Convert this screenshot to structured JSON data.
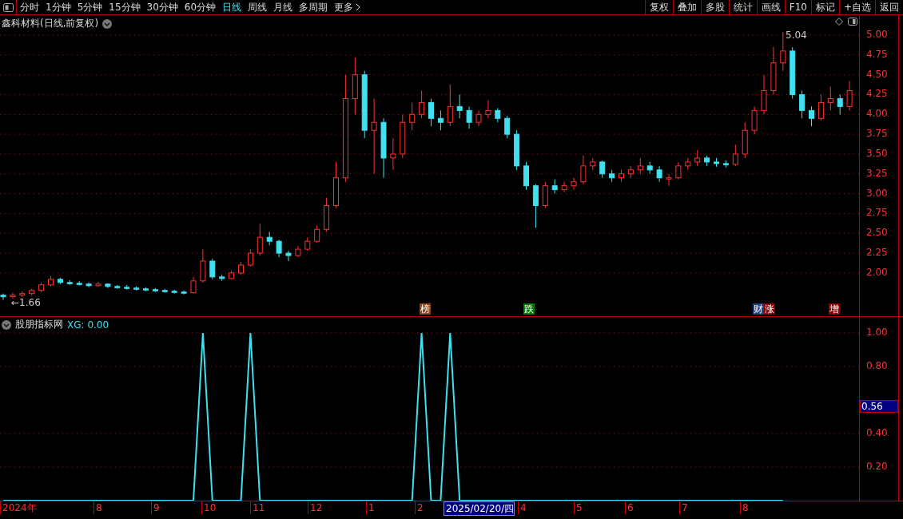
{
  "toolbar": {
    "tabs": [
      {
        "label": "分时",
        "selected": false
      },
      {
        "label": "1分钟",
        "selected": false
      },
      {
        "label": "5分钟",
        "selected": false
      },
      {
        "label": "15分钟",
        "selected": false
      },
      {
        "label": "30分钟",
        "selected": false
      },
      {
        "label": "60分钟",
        "selected": false
      },
      {
        "label": "日线",
        "selected": true
      },
      {
        "label": "周线",
        "selected": false
      },
      {
        "label": "月线",
        "selected": false
      },
      {
        "label": "多周期",
        "selected": false
      },
      {
        "label": "更多",
        "selected": false
      }
    ],
    "buttons": [
      "复权",
      "叠加",
      "多股",
      "统计",
      "画线",
      "F10",
      "标记",
      "+自选",
      "返回"
    ]
  },
  "main_chart": {
    "title": "鑫科材料(日线,前复权)",
    "low_label": "←1.66",
    "high_label": "5.04",
    "chart_data": {
      "type": "candlestick",
      "ohlc": [
        [
          1.72,
          1.74,
          1.66,
          1.7
        ],
        [
          1.7,
          1.75,
          1.68,
          1.72
        ],
        [
          1.72,
          1.77,
          1.7,
          1.74
        ],
        [
          1.74,
          1.8,
          1.72,
          1.78
        ],
        [
          1.78,
          1.88,
          1.76,
          1.85
        ],
        [
          1.85,
          1.96,
          1.83,
          1.92
        ],
        [
          1.92,
          1.94,
          1.86,
          1.88
        ],
        [
          1.88,
          1.91,
          1.85,
          1.87
        ],
        [
          1.87,
          1.9,
          1.84,
          1.86
        ],
        [
          1.86,
          1.88,
          1.82,
          1.84
        ],
        [
          1.84,
          1.89,
          1.83,
          1.86
        ],
        [
          1.86,
          1.87,
          1.81,
          1.83
        ],
        [
          1.83,
          1.85,
          1.8,
          1.82
        ],
        [
          1.82,
          1.85,
          1.79,
          1.81
        ],
        [
          1.81,
          1.83,
          1.78,
          1.8
        ],
        [
          1.8,
          1.82,
          1.77,
          1.79
        ],
        [
          1.79,
          1.81,
          1.76,
          1.78
        ],
        [
          1.78,
          1.8,
          1.75,
          1.77
        ],
        [
          1.77,
          1.79,
          1.74,
          1.76
        ],
        [
          1.76,
          1.78,
          1.73,
          1.75
        ],
        [
          1.75,
          1.95,
          1.74,
          1.9
        ],
        [
          1.9,
          2.3,
          1.88,
          2.15
        ],
        [
          2.15,
          2.18,
          1.92,
          1.95
        ],
        [
          1.95,
          1.98,
          1.9,
          1.93
        ],
        [
          1.93,
          2.03,
          1.92,
          2.0
        ],
        [
          2.0,
          2.14,
          1.98,
          2.1
        ],
        [
          2.1,
          2.3,
          2.08,
          2.25
        ],
        [
          2.25,
          2.62,
          2.22,
          2.45
        ],
        [
          2.45,
          2.52,
          2.35,
          2.4
        ],
        [
          2.4,
          2.42,
          2.2,
          2.25
        ],
        [
          2.25,
          2.28,
          2.15,
          2.22
        ],
        [
          2.22,
          2.34,
          2.2,
          2.3
        ],
        [
          2.3,
          2.45,
          2.28,
          2.4
        ],
        [
          2.4,
          2.6,
          2.38,
          2.55
        ],
        [
          2.55,
          2.95,
          2.52,
          2.85
        ],
        [
          2.85,
          3.4,
          2.82,
          3.2
        ],
        [
          3.2,
          4.5,
          3.15,
          4.2
        ],
        [
          4.2,
          4.72,
          4.0,
          4.5
        ],
        [
          4.5,
          4.55,
          3.7,
          3.8
        ],
        [
          3.8,
          4.2,
          3.25,
          3.9
        ],
        [
          3.9,
          3.95,
          3.2,
          3.45
        ],
        [
          3.45,
          3.7,
          3.3,
          3.5
        ],
        [
          3.5,
          4.0,
          3.45,
          3.9
        ],
        [
          3.9,
          4.15,
          3.8,
          4.0
        ],
        [
          4.0,
          4.3,
          3.95,
          4.15
        ],
        [
          4.15,
          4.2,
          3.85,
          3.95
        ],
        [
          3.95,
          4.05,
          3.8,
          3.9
        ],
        [
          3.9,
          4.38,
          3.85,
          4.1
        ],
        [
          4.1,
          4.25,
          3.95,
          4.05
        ],
        [
          4.05,
          4.1,
          3.82,
          3.9
        ],
        [
          3.9,
          4.05,
          3.85,
          4.0
        ],
        [
          4.0,
          4.18,
          3.95,
          4.05
        ],
        [
          4.05,
          4.08,
          3.9,
          3.95
        ],
        [
          3.95,
          3.98,
          3.7,
          3.75
        ],
        [
          3.75,
          3.8,
          3.3,
          3.35
        ],
        [
          3.35,
          3.4,
          3.05,
          3.1
        ],
        [
          3.1,
          3.12,
          2.57,
          2.85
        ],
        [
          2.85,
          3.15,
          2.82,
          3.1
        ],
        [
          3.1,
          3.18,
          3.0,
          3.05
        ],
        [
          3.05,
          3.15,
          3.02,
          3.1
        ],
        [
          3.1,
          3.2,
          3.05,
          3.15
        ],
        [
          3.15,
          3.48,
          3.12,
          3.35
        ],
        [
          3.35,
          3.45,
          3.3,
          3.4
        ],
        [
          3.4,
          3.42,
          3.2,
          3.25
        ],
        [
          3.25,
          3.3,
          3.15,
          3.2
        ],
        [
          3.2,
          3.3,
          3.15,
          3.25
        ],
        [
          3.25,
          3.35,
          3.2,
          3.3
        ],
        [
          3.3,
          3.45,
          3.25,
          3.35
        ],
        [
          3.35,
          3.4,
          3.25,
          3.3
        ],
        [
          3.3,
          3.35,
          3.15,
          3.2
        ],
        [
          3.2,
          3.25,
          3.1,
          3.2
        ],
        [
          3.2,
          3.4,
          3.18,
          3.35
        ],
        [
          3.35,
          3.45,
          3.3,
          3.4
        ],
        [
          3.4,
          3.55,
          3.35,
          3.45
        ],
        [
          3.45,
          3.48,
          3.35,
          3.4
        ],
        [
          3.4,
          3.45,
          3.34,
          3.38
        ],
        [
          3.38,
          3.42,
          3.33,
          3.37
        ],
        [
          3.37,
          3.62,
          3.35,
          3.5
        ],
        [
          3.5,
          3.9,
          3.45,
          3.8
        ],
        [
          3.8,
          4.1,
          3.75,
          4.05
        ],
        [
          4.05,
          4.5,
          4.0,
          4.3
        ],
        [
          4.3,
          4.85,
          4.25,
          4.65
        ],
        [
          4.65,
          5.04,
          4.55,
          4.8
        ],
        [
          4.8,
          4.85,
          4.2,
          4.25
        ],
        [
          4.25,
          4.3,
          3.95,
          4.05
        ],
        [
          4.05,
          4.1,
          3.85,
          3.95
        ],
        [
          3.95,
          4.25,
          3.92,
          4.15
        ],
        [
          4.15,
          4.35,
          4.05,
          4.2
        ],
        [
          4.2,
          4.25,
          4.0,
          4.1
        ],
        [
          4.1,
          4.42,
          4.05,
          4.3
        ]
      ],
      "ylim": [
        1.455,
        5.252
      ],
      "grid": true,
      "yticks": [
        {
          "value": 5,
          "label": "5.00"
        },
        {
          "value": 4.75,
          "label": "4.75"
        },
        {
          "value": 4.5,
          "label": "4.50"
        },
        {
          "value": 4.25,
          "label": "4.25"
        },
        {
          "value": 4,
          "label": "4.00"
        },
        {
          "value": 3.75,
          "label": "3.75"
        },
        {
          "value": 3.5,
          "label": "3.50"
        },
        {
          "value": 3.25,
          "label": "3.25"
        },
        {
          "value": 3,
          "label": "3.00"
        },
        {
          "value": 2.75,
          "label": "2.75"
        },
        {
          "value": 2.5,
          "label": "2.50"
        },
        {
          "value": 2.25,
          "label": "2.25"
        },
        {
          "value": 2,
          "label": "2.00"
        }
      ]
    },
    "markers": [
      {
        "label": "榜",
        "color": "#8b4513"
      },
      {
        "label": "跌",
        "color": "#007a00"
      },
      {
        "label": "财",
        "color": "#1f3f7f"
      },
      {
        "label": "涨",
        "color": "#8b0000"
      },
      {
        "label": "增",
        "color": "#8b0000"
      }
    ]
  },
  "indicator": {
    "name": "股朋指标网",
    "reading": "XG: 0.00",
    "current": "0.56",
    "chart_data": {
      "type": "line",
      "values": [
        0,
        0,
        0,
        0,
        0,
        0,
        0,
        0,
        0,
        0,
        0,
        0,
        0,
        0,
        0,
        0,
        0,
        0,
        0,
        0,
        0,
        1,
        0,
        0,
        0,
        0,
        1,
        0,
        0,
        0,
        0,
        0,
        0,
        0,
        0,
        0,
        0,
        0,
        0,
        0,
        0,
        0,
        0,
        0,
        1,
        0,
        0,
        1,
        0,
        0,
        0,
        0,
        0,
        0,
        0,
        0,
        0,
        0,
        0,
        0,
        0,
        0,
        0,
        0,
        0,
        0,
        0,
        0,
        0,
        0,
        0,
        0,
        0,
        0,
        0,
        0,
        0,
        0,
        0,
        0,
        0,
        0,
        0,
        null,
        null,
        null,
        null,
        null,
        null,
        null
      ],
      "ylim": [
        0,
        1.095
      ],
      "grid": true,
      "yticks": [
        {
          "value": 1,
          "label": "1.00"
        },
        {
          "value": 0.8,
          "label": "0.80"
        },
        {
          "value": 0.4,
          "label": "0.40"
        },
        {
          "value": 0.2,
          "label": "0.20"
        }
      ]
    }
  },
  "date_axis": {
    "labels": [
      "2024年",
      "8",
      "9",
      "10",
      "11",
      "12",
      "1",
      "2",
      "4",
      "5",
      "6",
      "7",
      "8"
    ],
    "cursor_date": "2025/02/20/四"
  }
}
